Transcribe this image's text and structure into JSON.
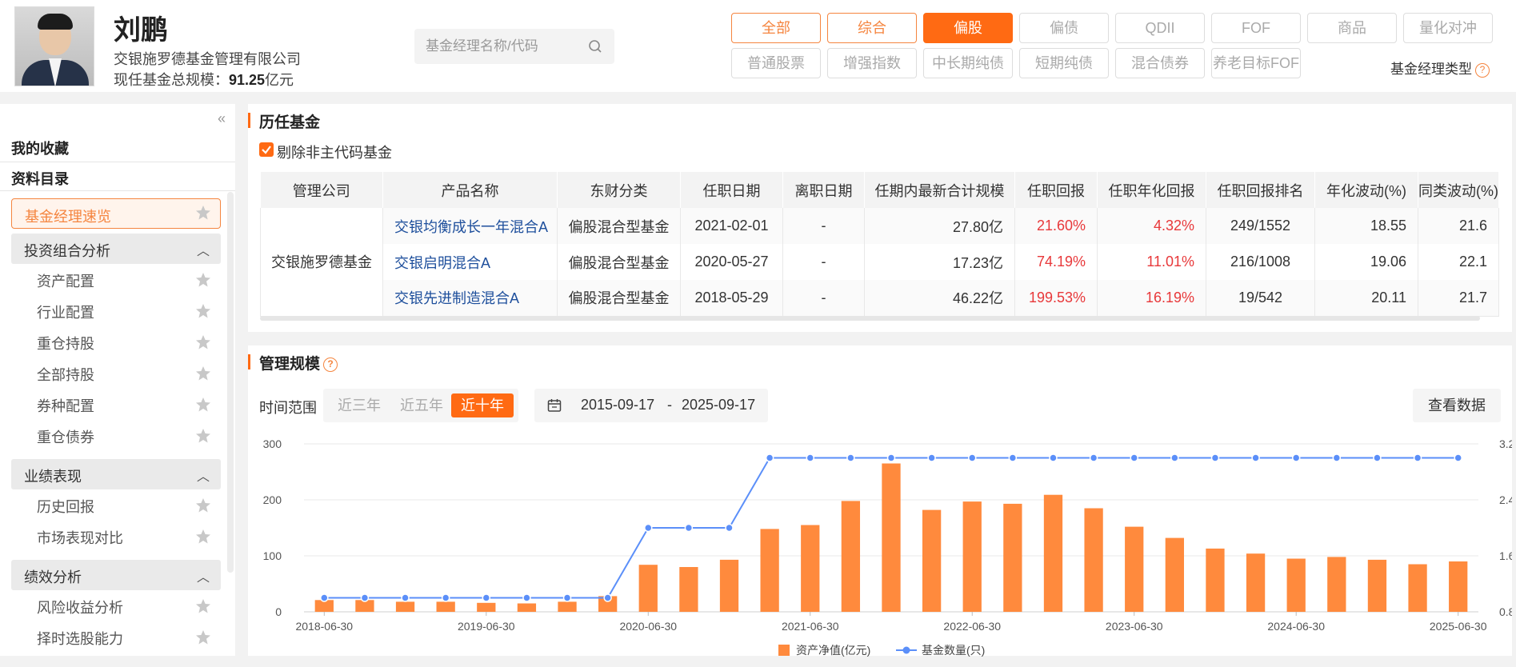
{
  "manager": {
    "name": "刘鹏",
    "company": "交银施罗德基金管理有限公司",
    "scale_label": "现任基金总规模：",
    "scale_value": "91.25",
    "scale_unit": "亿元"
  },
  "search": {
    "placeholder": "基金经理名称/代码"
  },
  "type_tabs_row1": [
    "全部",
    "综合",
    "偏股",
    "偏债",
    "QDII",
    "FOF",
    "商品",
    "量化对冲"
  ],
  "type_tabs_row2": [
    "普通股票",
    "增强指数",
    "中长期纯债",
    "短期纯债",
    "混合债券",
    "养老目标FOF"
  ],
  "type_tabs_active": "偏股",
  "manager_type_label": "基金经理类型",
  "sidebar": {
    "favorites": "我的收藏",
    "catalog": "资料目录",
    "active_item": "基金经理速览",
    "groups": [
      {
        "label": "投资组合分析",
        "items": [
          "资产配置",
          "行业配置",
          "重仓持股",
          "全部持股",
          "券种配置",
          "重仓债券"
        ]
      },
      {
        "label": "业绩表现",
        "items": [
          "历史回报",
          "市场表现对比"
        ]
      },
      {
        "label": "绩效分析",
        "items": [
          "风险收益分析",
          "择时选股能力"
        ]
      }
    ]
  },
  "history": {
    "title": "历任基金",
    "checkbox_label": "剔除非主代码基金",
    "columns": [
      "管理公司",
      "产品名称",
      "东财分类",
      "任职日期",
      "离职日期",
      "任期内最新合计规模",
      "任职回报",
      "任职年化回报",
      "任职回报排名",
      "年化波动(%)",
      "同类波动(%)"
    ],
    "company": "交银施罗德基金",
    "rows": [
      {
        "name": "交银均衡成长一年混合A",
        "category": "偏股混合型基金",
        "start": "2021-02-01",
        "end": "-",
        "scale": "27.80亿",
        "ret": "21.60%",
        "ann": "4.32%",
        "rank": "249/1552",
        "vol": "18.55",
        "peer_vol": "21.6"
      },
      {
        "name": "交银启明混合A",
        "category": "偏股混合型基金",
        "start": "2020-05-27",
        "end": "-",
        "scale": "17.23亿",
        "ret": "74.19%",
        "ann": "11.01%",
        "rank": "216/1008",
        "vol": "19.06",
        "peer_vol": "22.1"
      },
      {
        "name": "交银先进制造混合A",
        "category": "偏股混合型基金",
        "start": "2018-05-29",
        "end": "-",
        "scale": "46.22亿",
        "ret": "199.53%",
        "ann": "16.19%",
        "rank": "19/542",
        "vol": "20.11",
        "peer_vol": "21.7"
      }
    ]
  },
  "scale_panel": {
    "title": "管理规模",
    "range_label": "时间范围",
    "ranges": [
      "近三年",
      "近五年",
      "近十年"
    ],
    "active_range": "近十年",
    "date_start": "2015-09-17",
    "date_sep": "-",
    "date_end": "2025-09-17",
    "view_data": "查看数据"
  },
  "chart_data": {
    "type": "bar",
    "x_tick_labels": [
      "2018-06-30",
      "2019-06-30",
      "2020-06-30",
      "2021-06-30",
      "2022-06-30",
      "2023-06-30",
      "2024-06-30",
      "2025-06-30"
    ],
    "categories": [
      "2018-06-30",
      "2018-09-30",
      "2018-12-31",
      "2019-03-31",
      "2019-06-30",
      "2019-09-30",
      "2019-12-31",
      "2020-03-31",
      "2020-06-30",
      "2020-09-30",
      "2020-12-31",
      "2021-03-31",
      "2021-06-30",
      "2021-09-30",
      "2021-12-31",
      "2022-03-31",
      "2022-06-30",
      "2022-09-30",
      "2022-12-31",
      "2023-03-31",
      "2023-06-30",
      "2023-09-30",
      "2023-12-31",
      "2024-03-31",
      "2024-06-30",
      "2024-09-30",
      "2024-12-31",
      "2025-03-31",
      "2025-06-30"
    ],
    "series": [
      {
        "name": "资产净值(亿元)",
        "axis": "left",
        "kind": "bar",
        "color": "#ff8a3d",
        "values": [
          21,
          21,
          18,
          18,
          16,
          15,
          18,
          28,
          84,
          80,
          93,
          148,
          155,
          198,
          265,
          182,
          197,
          193,
          209,
          185,
          152,
          132,
          113,
          104,
          95,
          98,
          93,
          85,
          90
        ]
      },
      {
        "name": "基金数量(只)",
        "axis": "right",
        "kind": "line",
        "color": "#5b8ff9",
        "values": [
          1,
          1,
          1,
          1,
          1,
          1,
          1,
          1,
          2,
          2,
          2,
          3,
          3,
          3,
          3,
          3,
          3,
          3,
          3,
          3,
          3,
          3,
          3,
          3,
          3,
          3,
          3,
          3,
          3
        ]
      }
    ],
    "y_left": {
      "ticks": [
        0,
        100,
        200,
        300
      ],
      "ylim": [
        0,
        300
      ]
    },
    "y_right": {
      "ticks": [
        0.8,
        1.6,
        2.4,
        3.2
      ],
      "ylim": [
        0.8,
        3.2
      ]
    },
    "grid": true,
    "legend_position": "bottom"
  }
}
